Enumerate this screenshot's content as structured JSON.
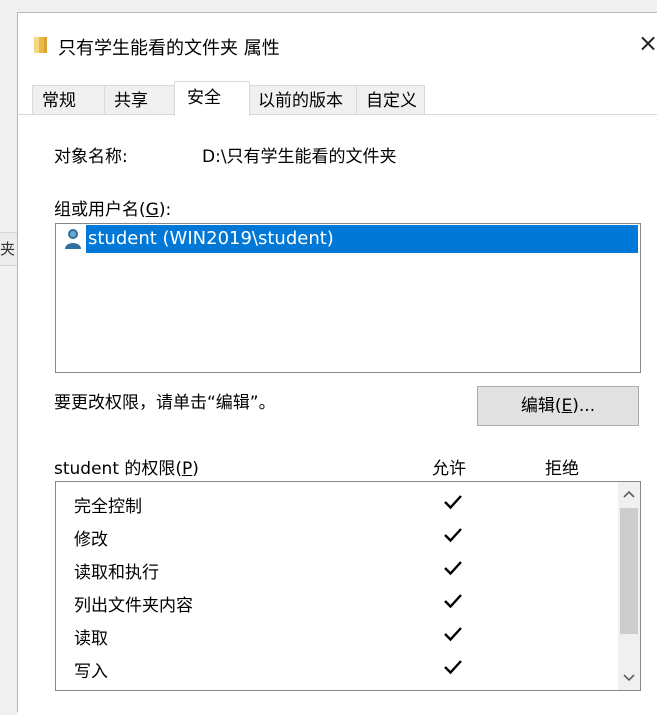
{
  "background": {
    "window_fragment_text": "夹"
  },
  "dialog": {
    "title": "只有学生能看的文件夹 属性",
    "close_symbol": "×",
    "tabs": [
      {
        "label": "常规",
        "active": false
      },
      {
        "label": "共享",
        "active": false
      },
      {
        "label": "安全",
        "active": true
      },
      {
        "label": "以前的版本",
        "active": false
      },
      {
        "label": "自定义",
        "active": false
      }
    ],
    "security": {
      "object_name_label": "对象名称:",
      "object_name_value": "D:\\只有学生能看的文件夹",
      "groups_label_prefix": "组或用户名(",
      "groups_label_key": "G",
      "groups_label_suffix": "):",
      "users": [
        {
          "name": "student (WIN2019\\student)",
          "selected": true,
          "icon": "user-icon"
        }
      ],
      "change_hint": "要更改权限，请单击“编辑”。",
      "edit_button_prefix": "编辑(",
      "edit_button_key": "E",
      "edit_button_suffix": ")...",
      "permissions_for_prefix": "student 的权限(",
      "permissions_for_key": "P",
      "permissions_for_suffix": ")",
      "allow_header": "允许",
      "deny_header": "拒绝",
      "permissions": [
        {
          "name": "完全控制",
          "allow": true,
          "deny": false
        },
        {
          "name": "修改",
          "allow": true,
          "deny": false
        },
        {
          "name": "读取和执行",
          "allow": true,
          "deny": false
        },
        {
          "name": "列出文件夹内容",
          "allow": true,
          "deny": false
        },
        {
          "name": "读取",
          "allow": true,
          "deny": false
        },
        {
          "name": "写入",
          "allow": true,
          "deny": false
        }
      ]
    }
  },
  "colors": {
    "selection": "#0078d7",
    "folder": "#e8b94a",
    "user_icon": "#2e6f9e"
  }
}
